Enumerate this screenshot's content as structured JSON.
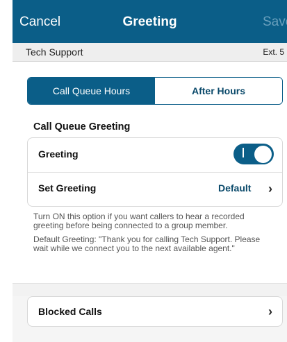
{
  "header": {
    "cancel_label": "Cancel",
    "title": "Greeting",
    "save_label": "Save"
  },
  "subheader": {
    "name": "Tech Support",
    "extension": "Ext. 5"
  },
  "tabs": [
    {
      "label": "Call Queue Hours",
      "active": true
    },
    {
      "label": "After Hours",
      "active": false
    }
  ],
  "section": {
    "title": "Call Queue Greeting"
  },
  "settings": {
    "greeting_label": "Greeting",
    "greeting_enabled": true,
    "set_greeting_label": "Set Greeting",
    "set_greeting_value": "Default"
  },
  "help": {
    "line1": "Turn ON this option if you want callers to hear a recorded greeting before being connected to a group member.",
    "line2": "Default Greeting: \"Thank you for calling Tech Support. Please wait while we connect you to the next available agent.\""
  },
  "blocked_calls_label": "Blocked Calls",
  "colors": {
    "accent": "#0b5e88",
    "background": "#f5f5f5"
  },
  "icons": {
    "chevron": "chevron-right-icon"
  }
}
